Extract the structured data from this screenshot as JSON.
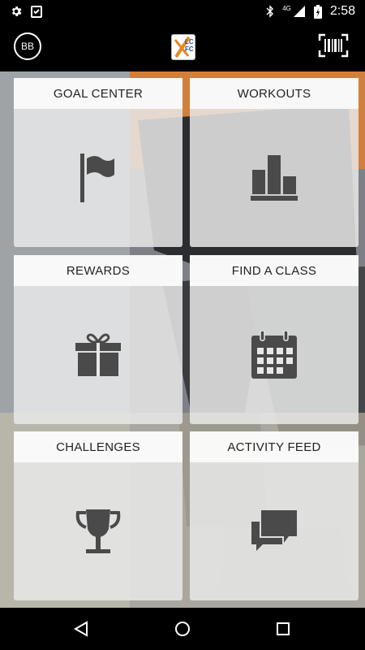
{
  "status_bar": {
    "network": "4G",
    "time": "2:58",
    "icons": [
      "settings-gear-icon",
      "clipboard-check-icon",
      "bluetooth-icon",
      "signal-icon",
      "battery-charging-icon"
    ]
  },
  "app_bar": {
    "avatar_initials": "BB",
    "logo_text": "LCFC",
    "barcode_icon": "barcode-scan-icon"
  },
  "tiles": [
    {
      "label": "GOAL CENTER",
      "icon": "flag-icon"
    },
    {
      "label": "WORKOUTS",
      "icon": "bar-chart-icon"
    },
    {
      "label": "REWARDS",
      "icon": "gift-icon"
    },
    {
      "label": "FIND A CLASS",
      "icon": "calendar-icon"
    },
    {
      "label": "CHALLENGES",
      "icon": "trophy-icon"
    },
    {
      "label": "ACTIVITY FEED",
      "icon": "chat-bubbles-icon"
    }
  ],
  "nav_bar": {
    "buttons": [
      "back-icon",
      "home-icon",
      "recents-icon"
    ]
  },
  "colors": {
    "tile_icon": "#4a4a4a",
    "logo_accent": "#e8861c",
    "logo_blue": "#2a4d9b"
  }
}
